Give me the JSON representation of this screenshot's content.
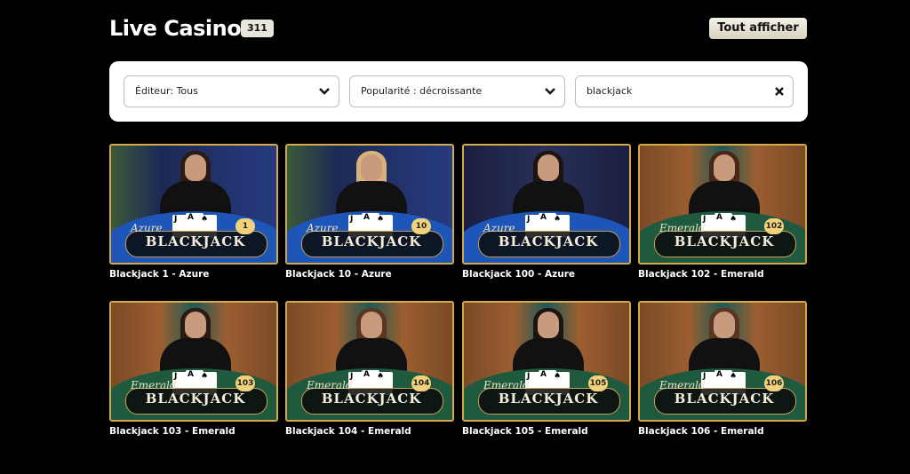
{
  "header": {
    "title": "Live Casino",
    "count": "311",
    "show_all_label": "Tout afficher"
  },
  "filters": {
    "editor": "Éditeur: Tous",
    "sort": "Popularité : décroissante",
    "search_value": "blackjack"
  },
  "games": [
    {
      "name": "Blackjack 1 - Azure",
      "variant": "Azure",
      "logo": "BLACKJACK",
      "number": "1",
      "theme": "azure",
      "hair": "#2a1a12"
    },
    {
      "name": "Blackjack 10 - Azure",
      "variant": "Azure",
      "logo": "BLACKJACK",
      "number": "10",
      "theme": "azure",
      "hair": "#d9b27a"
    },
    {
      "name": "Blackjack 100 - Azure",
      "variant": "Azure",
      "logo": "BLACKJACK",
      "number": "",
      "theme": "azure-dark",
      "hair": "#1b1410"
    },
    {
      "name": "Blackjack 102 - Emerald",
      "variant": "Emerald",
      "logo": "BLACKJACK",
      "number": "102",
      "theme": "emerald",
      "hair": "#4a2617"
    },
    {
      "name": "Blackjack 103 - Emerald",
      "variant": "Emerald",
      "logo": "BLACKJACK",
      "number": "103",
      "theme": "emerald",
      "hair": "#2a1a12"
    },
    {
      "name": "Blackjack 104 - Emerald",
      "variant": "Emerald",
      "logo": "BLACKJACK",
      "number": "104",
      "theme": "emerald",
      "hair": "#5a3520"
    },
    {
      "name": "Blackjack 105 - Emerald",
      "variant": "Emerald",
      "logo": "BLACKJACK",
      "number": "105",
      "theme": "emerald",
      "hair": "#1b1410"
    },
    {
      "name": "Blackjack 106 - Emerald",
      "variant": "Emerald",
      "logo": "BLACKJACK",
      "number": "106",
      "theme": "emerald",
      "hair": "#5a3520"
    }
  ],
  "colors": {
    "accent_gold": "#d4a94a",
    "azure_table": "#1d56b8",
    "emerald_table": "#1f5a3f"
  },
  "icons": {
    "dropdown": "chevron-down-icon",
    "clear": "close-icon"
  }
}
